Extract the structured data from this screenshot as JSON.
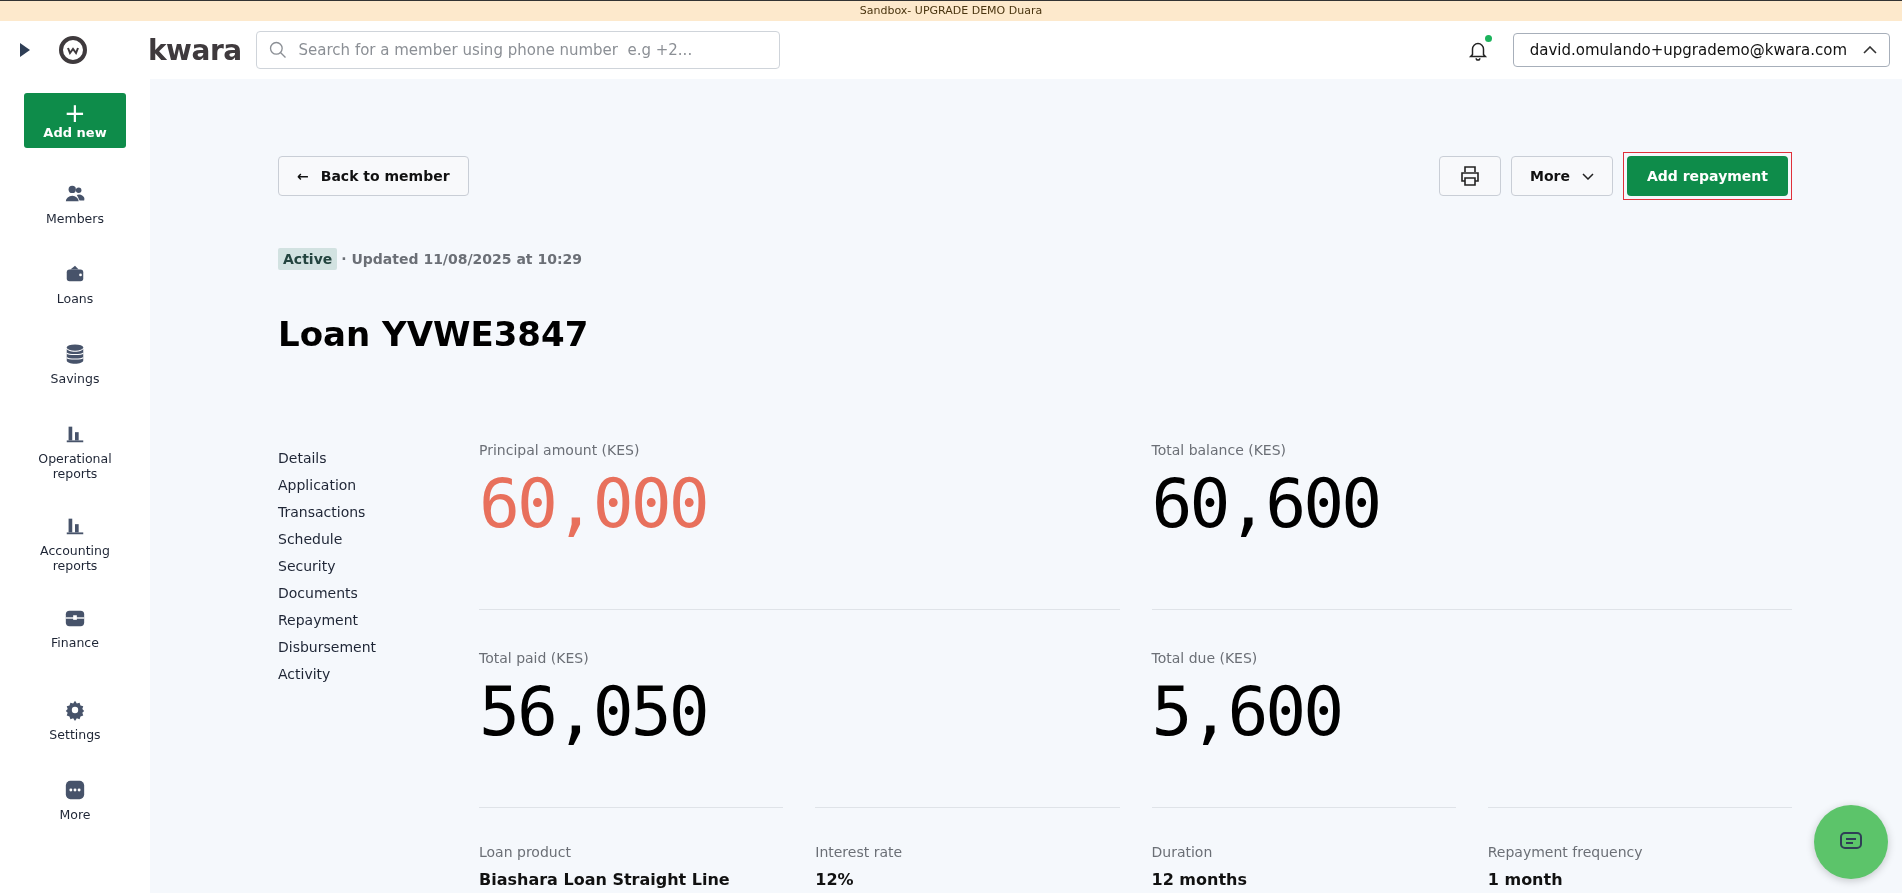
{
  "banner": {
    "text": "Sandbox- UPGRADE DEMO Duara"
  },
  "header": {
    "brand": "kwara",
    "search": {
      "placeholder": "Search for a member using phone number  e.g +2..."
    },
    "notifications": {
      "unread": true
    },
    "user": {
      "email": "david.omulando+upgrademo@kwara.com",
      "expanded": true
    }
  },
  "sidebar": {
    "add_button": {
      "icon": "+",
      "label": "Add new"
    },
    "items": [
      {
        "label": "Members"
      },
      {
        "label": "Loans"
      },
      {
        "label": "Savings"
      },
      {
        "label": "Operational reports"
      },
      {
        "label": "Accounting reports"
      },
      {
        "label": "Finance"
      },
      {
        "label": "Settings"
      },
      {
        "label": "More"
      }
    ]
  },
  "toolbar": {
    "back": {
      "arrow": "←",
      "label": "Back to member"
    },
    "more": {
      "label": "More"
    },
    "primary": {
      "label": "Add repayment",
      "highlighted": true
    }
  },
  "status": {
    "badge": "Active",
    "updated": "· Updated 11/08/2025 at 10:29"
  },
  "title": "Loan YVWE3847",
  "section_nav": [
    "Details",
    "Application",
    "Transactions",
    "Schedule",
    "Security",
    "Documents",
    "Repayment",
    "Disbursement",
    "Activity"
  ],
  "stats": [
    {
      "label": "Principal amount (KES)",
      "value": "60,000",
      "color": "#e8705c"
    },
    {
      "label": "Total balance (KES)",
      "value": "60,600",
      "color": "#000000"
    },
    {
      "label": "Total paid (KES)",
      "value": "56,050",
      "color": "#000000"
    },
    {
      "label": "Total due (KES)",
      "value": "5,600",
      "color": "#000000"
    }
  ],
  "details": [
    {
      "label": "Loan product",
      "value": "Biashara Loan Straight Line"
    },
    {
      "label": "Interest rate",
      "value": "12%"
    },
    {
      "label": "Duration",
      "value": "12 months"
    },
    {
      "label": "Repayment frequency",
      "value": "1 month"
    }
  ]
}
